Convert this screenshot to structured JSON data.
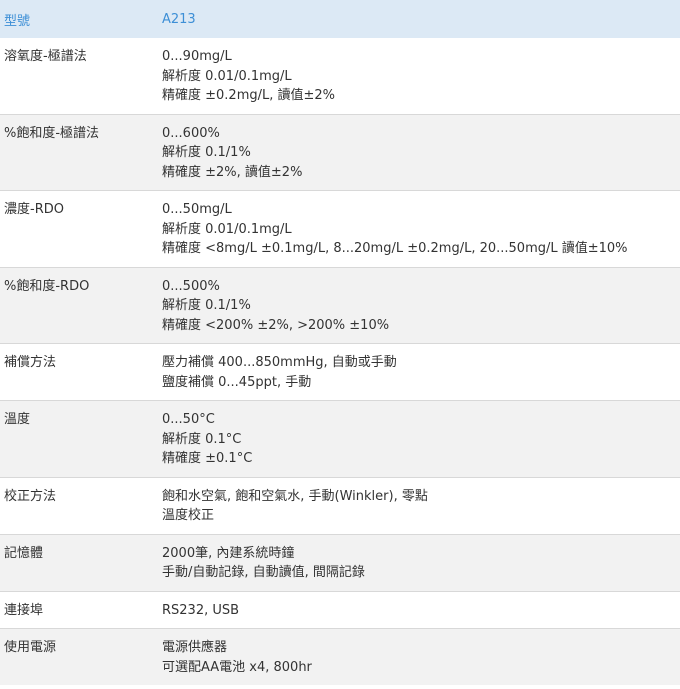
{
  "header": {
    "label": "型號",
    "value": "A213"
  },
  "rows": [
    {
      "label": "溶氧度-極譜法",
      "lines": [
        "0...90mg/L",
        "解析度 0.01/0.1mg/L",
        "精確度 ±0.2mg/L, 讀值±2%"
      ]
    },
    {
      "label": "%飽和度-極譜法",
      "lines": [
        "0...600%",
        "解析度 0.1/1%",
        "精確度 ±2%, 讀值±2%"
      ]
    },
    {
      "label": "濃度-RDO",
      "lines": [
        "0...50mg/L",
        "解析度 0.01/0.1mg/L",
        "精確度 <8mg/L ±0.1mg/L, 8...20mg/L ±0.2mg/L, 20...50mg/L 讀值±10%"
      ]
    },
    {
      "label": "%飽和度-RDO",
      "lines": [
        "0...500%",
        "解析度 0.1/1%",
        "精確度 <200% ±2%, >200% ±10%"
      ]
    },
    {
      "label": "補償方法",
      "lines": [
        "壓力補償 400...850mmHg, 自動或手動",
        "鹽度補償 0...45ppt, 手動"
      ]
    },
    {
      "label": "溫度",
      "lines": [
        "0...50°C",
        "解析度 0.1°C",
        "精確度 ±0.1°C"
      ]
    },
    {
      "label": "校正方法",
      "lines": [
        "飽和水空氣, 飽和空氣水, 手動(Winkler), 零點",
        "溫度校正"
      ]
    },
    {
      "label": "記憶體",
      "lines": [
        "2000筆, 內建系統時鐘",
        "手動/自動記錄, 自動讀值, 間隔記錄"
      ]
    },
    {
      "label": "連接埠",
      "lines": [
        "RS232, USB"
      ]
    },
    {
      "label": "使用電源",
      "lines": [
        "電源供應器",
        "可選配AA電池 x4, 800hr"
      ]
    }
  ]
}
